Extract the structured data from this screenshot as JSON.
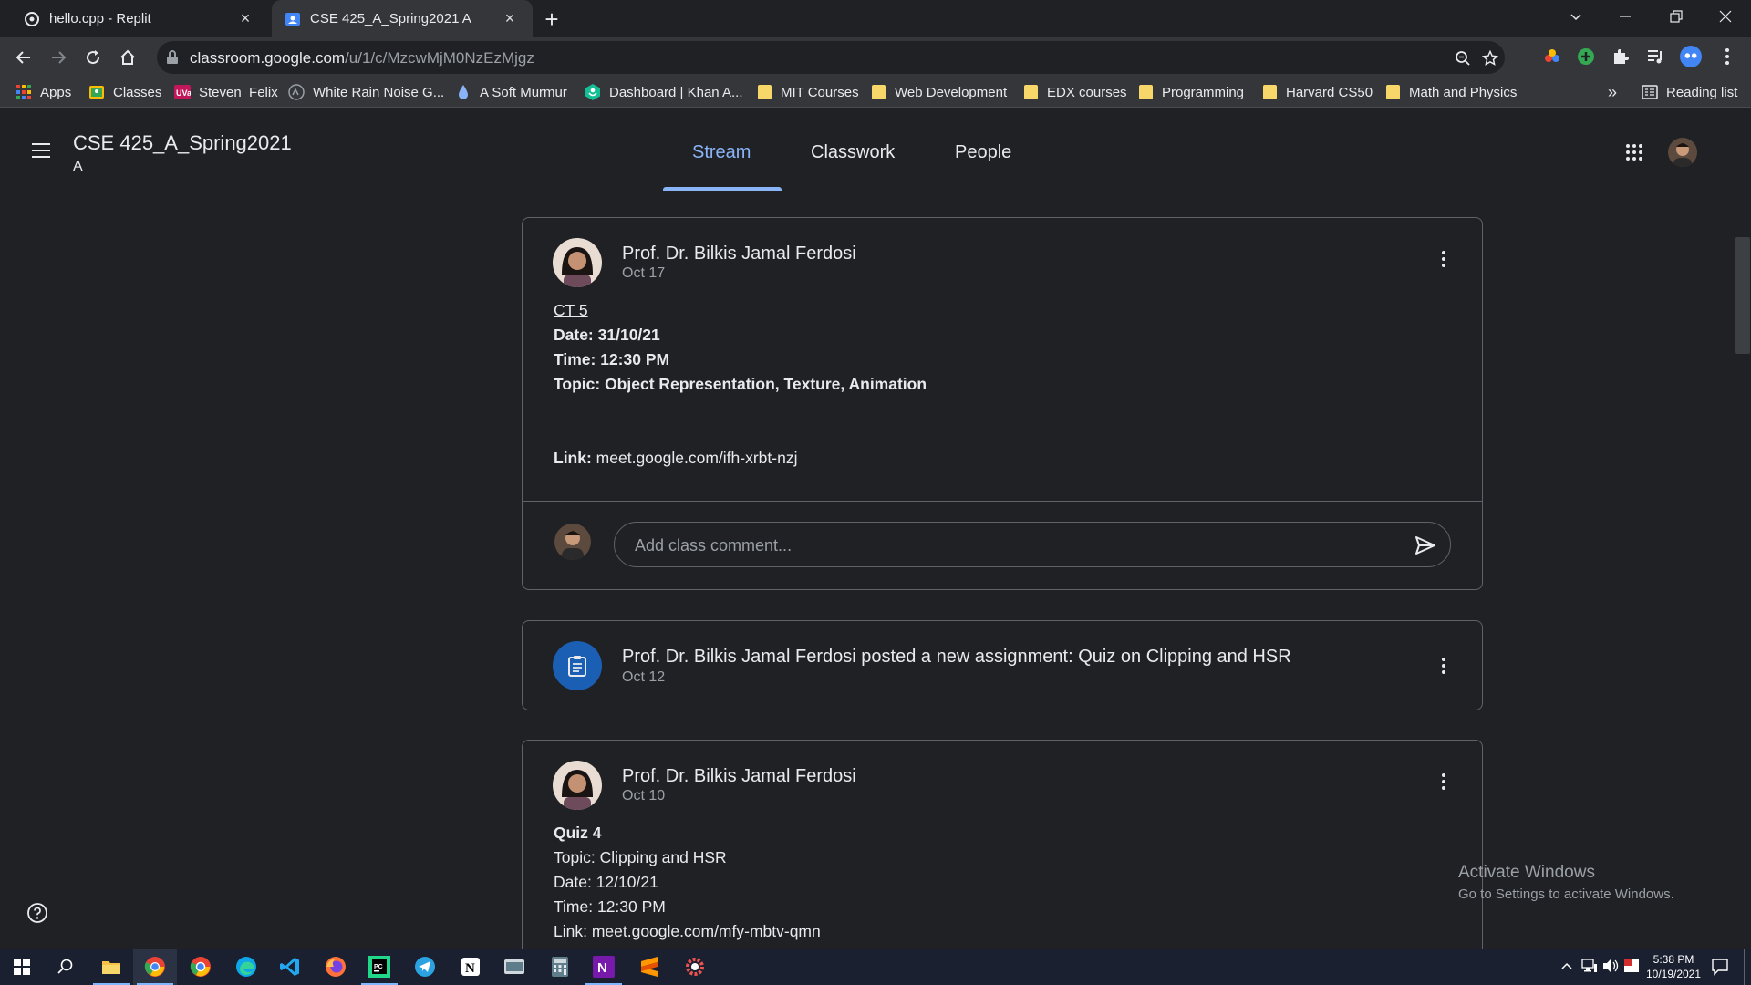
{
  "browser": {
    "tabs": [
      {
        "title": "hello.cpp - Replit",
        "icon": "replit-icon",
        "active": false
      },
      {
        "title": "CSE 425_A_Spring2021 A",
        "icon": "classroom-icon",
        "active": true
      }
    ],
    "address": {
      "host": "classroom.google.com",
      "path": "/u/1/c/MzcwMjM0NzEzMjgz"
    },
    "bookmarks": [
      {
        "label": "Apps",
        "icon": "apps-grid-icon"
      },
      {
        "label": "Classes",
        "icon": "classroom-icon"
      },
      {
        "label": "Steven_Felix",
        "icon": "uva-icon"
      },
      {
        "label": "White Rain Noise G...",
        "icon": "noise-icon"
      },
      {
        "label": "A Soft Murmur",
        "icon": "drop-icon"
      },
      {
        "label": "Dashboard | Khan A...",
        "icon": "khan-icon"
      },
      {
        "label": "MIT Courses",
        "icon": "folder-icon"
      },
      {
        "label": "Web Development",
        "icon": "folder-icon"
      },
      {
        "label": "EDX courses",
        "icon": "folder-icon"
      },
      {
        "label": "Programming",
        "icon": "folder-icon"
      },
      {
        "label": "Harvard CS50",
        "icon": "folder-icon"
      },
      {
        "label": "Math and Physics",
        "icon": "folder-icon"
      }
    ],
    "overflow_label": "»",
    "reading_list": "Reading list"
  },
  "classroom": {
    "course_title": "CSE 425_A_Spring2021",
    "section": "A",
    "nav_tabs": [
      "Stream",
      "Classwork",
      "People"
    ],
    "active_tab": "Stream"
  },
  "stream": {
    "post1": {
      "author": "Prof. Dr. Bilkis Jamal Ferdosi",
      "date": "Oct 17",
      "title_link": "CT 5",
      "lines": [
        {
          "label": "Date:",
          "value": " 31/10/21"
        },
        {
          "label": "Time:",
          "value": " 12:30 PM"
        },
        {
          "label": "Topic:",
          "value": " Object Representation, Texture, Animation"
        },
        {
          "label": "Link:",
          "value": " meet.google.com/ifh-xrbt-nzj"
        }
      ],
      "comment_placeholder": "Add class comment..."
    },
    "assignment": {
      "text": "Prof. Dr. Bilkis Jamal Ferdosi posted a new assignment: Quiz on Clipping and HSR",
      "date": "Oct 12"
    },
    "post2": {
      "author": "Prof. Dr. Bilkis Jamal Ferdosi",
      "date": "Oct 10",
      "title": "Quiz 4",
      "lines": [
        "Topic: Clipping and HSR",
        "Date: 12/10/21",
        "Time: 12:30 PM",
        "Link: meet.google.com/mfy-mbtv-qmn"
      ]
    }
  },
  "watermark": {
    "title": "Activate Windows",
    "subtitle": "Go to Settings to activate Windows."
  },
  "taskbar": {
    "time": "5:38 PM",
    "date": "10/19/2021"
  },
  "colors": {
    "accent": "#8ab4f8",
    "background": "#202124",
    "assignment_icon_bg": "#1a5fb4"
  }
}
